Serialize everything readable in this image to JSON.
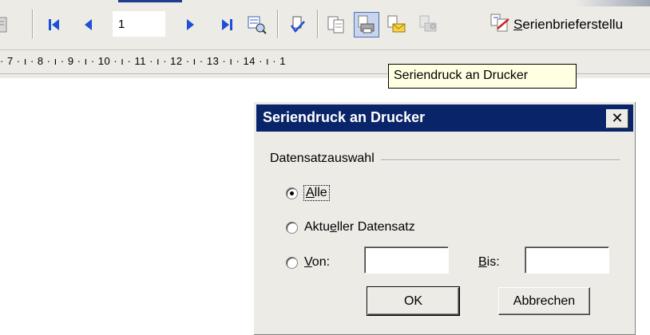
{
  "toolbar": {
    "record_number": "1",
    "buttons": [
      {
        "name": "edit-source-icon"
      },
      {
        "name": "first-record-icon"
      },
      {
        "name": "previous-record-icon"
      },
      {
        "name": "next-record-icon"
      },
      {
        "name": "last-record-icon"
      },
      {
        "name": "find-record-icon"
      },
      {
        "name": "check-errors-icon"
      },
      {
        "name": "merge-to-new-document-icon"
      },
      {
        "name": "merge-to-printer-icon"
      },
      {
        "name": "merge-to-email-icon"
      },
      {
        "name": "merge-to-fax-icon"
      },
      {
        "name": "mail-merge-wizard-icon"
      }
    ],
    "wizard_label_prefix": "S",
    "wizard_label_rest": "erienbrieferstellu"
  },
  "ruler": {
    "text": "· 7 · ı · 8 · ı · 9 · ı · 10 · ı · 11 · ı · 12 · ı · 13 · ı · 14 · ı · 1"
  },
  "tooltip": {
    "text": "Seriendruck an Drucker"
  },
  "dialog": {
    "title": "Seriendruck an Drucker",
    "close_symbol": "✕",
    "group_label": "Datensatzauswahl",
    "options": {
      "alle": {
        "pre": "",
        "ul": "A",
        "post": "lle",
        "selected": true
      },
      "aktueller": {
        "pre": "Aktu",
        "ul": "e",
        "post": "ller Datensatz",
        "selected": false
      },
      "von": {
        "pre": "",
        "ul": "V",
        "post": "on:",
        "selected": false
      }
    },
    "von_value": "",
    "bis_label_ul": "B",
    "bis_label_rest": "is:",
    "bis_value": "",
    "ok_label": "OK",
    "cancel_label": "Abbrechen"
  },
  "colors": {
    "titlebar": "#0a246a",
    "dialog_bg": "#ecebe6",
    "tooltip_bg": "#ffffe1"
  }
}
